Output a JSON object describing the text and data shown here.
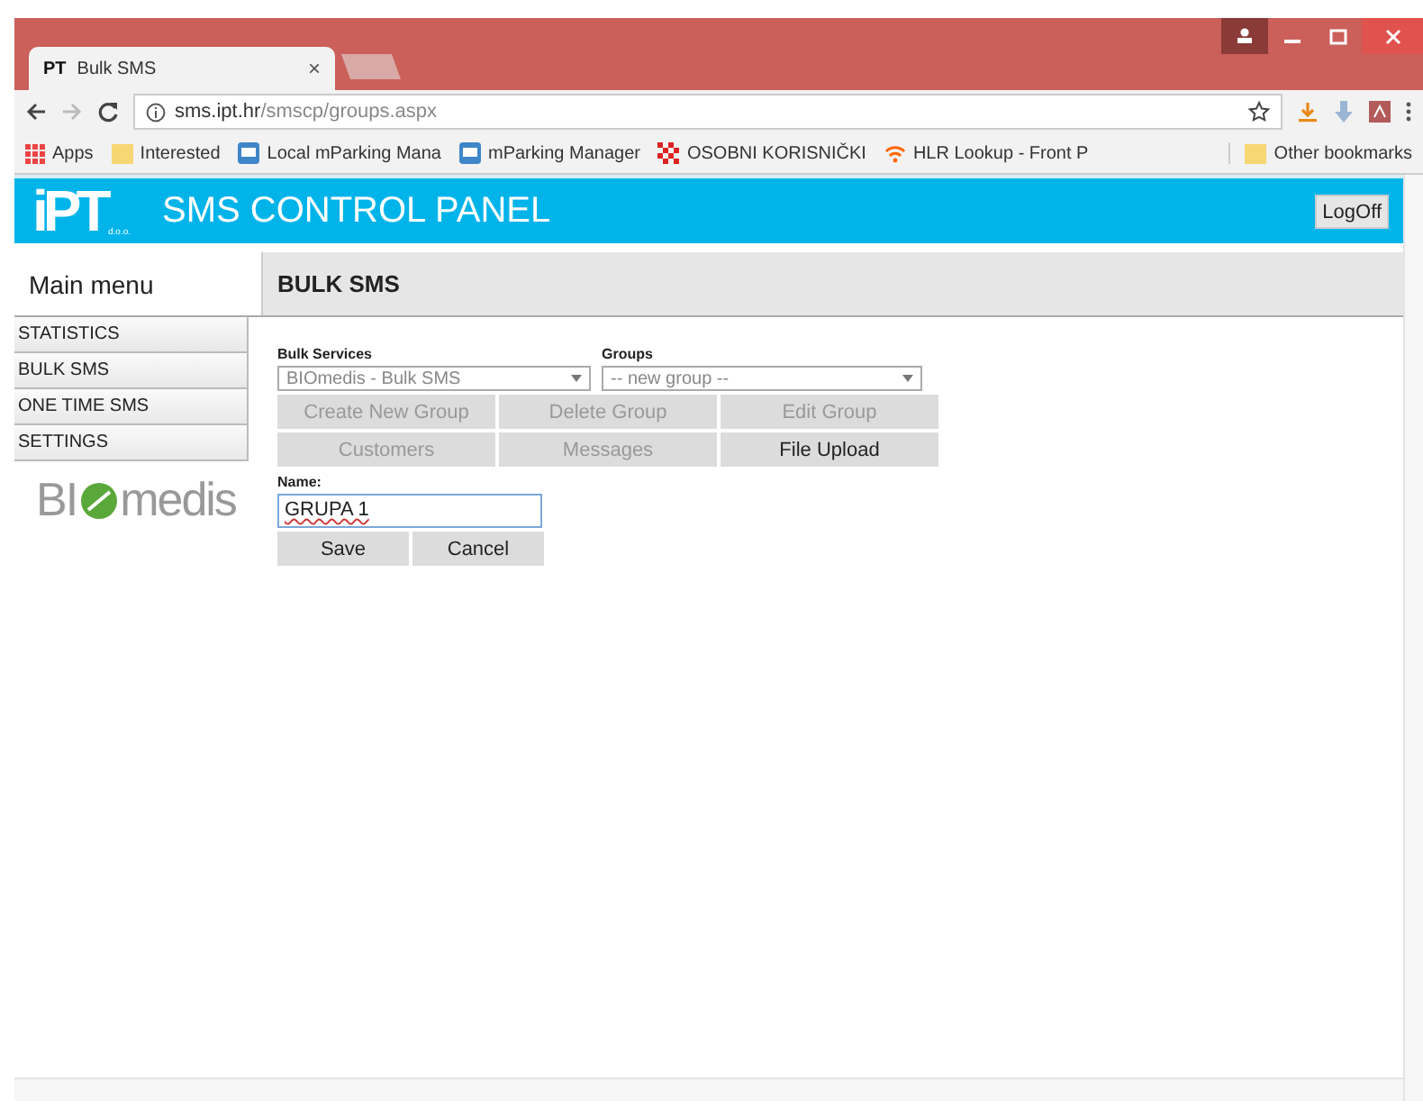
{
  "browser": {
    "tab": {
      "favicon": "PT",
      "title": "Bulk SMS",
      "close": "×"
    },
    "address": "sms.ipt.hr",
    "path": "/smscp/groups.aspx",
    "bookmarks": [
      {
        "kind": "apps",
        "label": "Apps"
      },
      {
        "kind": "folder",
        "label": "Interested"
      },
      {
        "kind": "page",
        "label": "Local mParking Mana"
      },
      {
        "kind": "page",
        "label": "mParking Manager"
      },
      {
        "kind": "checker",
        "label": "OSOBNI KORISNIČKI"
      },
      {
        "kind": "wifi",
        "label": "HLR Lookup - Front P"
      }
    ],
    "other_bookmarks": "Other bookmarks"
  },
  "header": {
    "logo": "iPT",
    "logo_suffix": "d.o.o.",
    "title": "SMS CONTROL PANEL",
    "logoff": "LogOff"
  },
  "sidebar": {
    "title": "Main menu",
    "items": [
      {
        "label": "STATISTICS"
      },
      {
        "label": "BULK SMS"
      },
      {
        "label": "ONE TIME SMS"
      },
      {
        "label": "SETTINGS"
      }
    ],
    "client_logo": {
      "before": "BI",
      "after": "medis"
    }
  },
  "page_title": "BULK SMS",
  "form": {
    "bulk_services": {
      "label": "Bulk Services",
      "value": "BIOmedis - Bulk SMS"
    },
    "groups": {
      "label": "Groups",
      "value": "-- new group --"
    },
    "buttons": [
      {
        "label": "Create New Group",
        "disabled": true
      },
      {
        "label": "Delete Group",
        "disabled": true
      },
      {
        "label": "Edit Group",
        "disabled": true
      },
      {
        "label": "Customers",
        "disabled": true
      },
      {
        "label": "Messages",
        "disabled": true
      },
      {
        "label": "File Upload",
        "disabled": false
      }
    ],
    "name": {
      "label": "Name:",
      "value": "GRUPA 1"
    },
    "actions": [
      "Save",
      "Cancel"
    ]
  }
}
